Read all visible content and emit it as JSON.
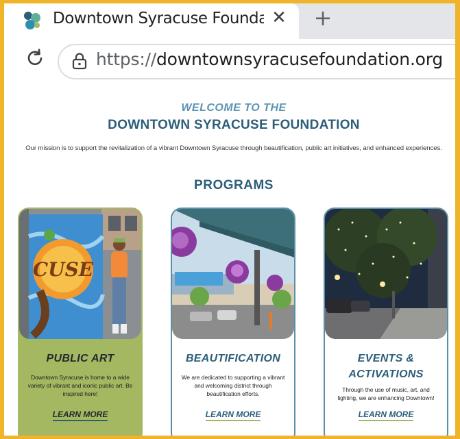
{
  "browser": {
    "tab_title": "Downtown Syracuse Foundation | D",
    "close_glyph": "✕",
    "new_tab_glyph": "+",
    "url_scheme": "https://",
    "url_host": "downtownsyracusefoundation.org",
    "icons": [
      "favicon-icon",
      "close-icon",
      "new-tab-icon",
      "reload-icon",
      "lock-icon"
    ]
  },
  "hero": {
    "welcome": "WELCOME TO THE",
    "title": "DOWNTOWN SYRACUSE FOUNDATION",
    "mission": "Our mission is to support the revitalization of a vibrant Downtown Syracuse through beautification, public art initiatives, and enhanced experiences."
  },
  "programs": {
    "heading": "PROGRAMS",
    "cards": [
      {
        "title": "PUBLIC ART",
        "description": "Downtown Syracuse is home to a wide variety of vibrant and iconic public art. Be inspired here!",
        "link": "LEARN MORE",
        "mural_text": "CUSE"
      },
      {
        "title": "BEAUTIFICATION",
        "description": "We are dedicated to supporting a vibrant and welcoming district through beautification efforts.",
        "link": "LEARN MORE"
      },
      {
        "title_line1": "EVENTS &",
        "title_line2": "ACTIVATIONS",
        "description": "Through the use of music, art, and lighting, we are enhancing Downtown!",
        "link": "LEARN MORE"
      }
    ]
  },
  "colors": {
    "border": "#f0b42a",
    "accent_green": "#a3b860",
    "heading_blue": "#2c5e7a",
    "subheading_blue": "#5b95b3"
  }
}
